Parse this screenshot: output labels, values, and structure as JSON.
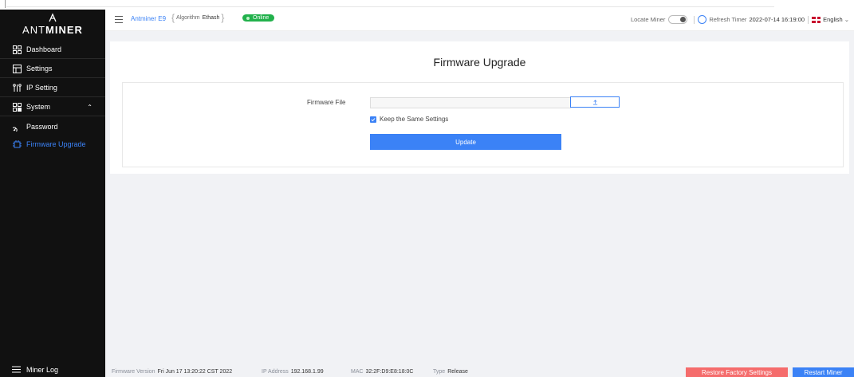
{
  "brand": {
    "logo_prefix": "ANT",
    "logo_bold": "MINER"
  },
  "sidebar": {
    "items": [
      {
        "label": "Dashboard",
        "icon": "dashboard-icon"
      },
      {
        "label": "Settings",
        "icon": "settings-icon"
      },
      {
        "label": "IP Setting",
        "icon": "ip-setting-icon"
      },
      {
        "label": "System",
        "icon": "system-icon",
        "expanded": true
      },
      {
        "label": "Password",
        "icon": "password-icon"
      },
      {
        "label": "Firmware Upgrade",
        "icon": "firmware-icon",
        "active": true
      }
    ],
    "miner_log": "Miner Log"
  },
  "header": {
    "model": "Antminer E9",
    "algorithm_label": "Algorithm",
    "algorithm_value": "Ethash",
    "status": "Online",
    "locate_label": "Locate Miner",
    "refresh_label": "Refresh Timer",
    "refresh_value": "2022-07-14 16:19:00",
    "language": "English"
  },
  "page": {
    "title": "Firmware Upgrade",
    "firmware_file_label": "Firmware File",
    "firmware_file_value": "",
    "keep_settings_label": "Keep the Same Settings",
    "keep_settings_checked": true,
    "update_label": "Update"
  },
  "footer": {
    "fw_version_label": "Firmware Version",
    "fw_version_value": "Fri Jun 17 13:20:22 CST 2022",
    "ip_label": "IP Address",
    "ip_value": "192.168.1.99",
    "mac_label": "MAC",
    "mac_value": "32:2F:D9:E8:18:0C",
    "type_label": "Type",
    "type_value": "Release",
    "restore_label": "Restore Factory Settings",
    "restart_label": "Restart Miner"
  },
  "colors": {
    "accent": "#3b82f6",
    "online": "#22b14c",
    "danger": "#f56c6c",
    "sidebar_bg": "#111111"
  }
}
